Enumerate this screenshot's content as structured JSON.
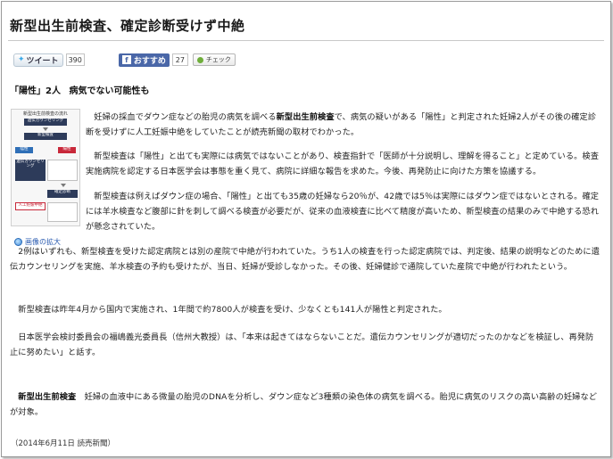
{
  "article": {
    "title": "新型出生前検査、確定診断受けず中絶",
    "share": {
      "tweet_label": "ツイート",
      "tweet_count": "390",
      "facebook_label": "おすすめ",
      "facebook_count": "27",
      "check_label": "チェック"
    },
    "subheading": {
      "part1": "「陽性」2人",
      "part2": "病気でない可能性も"
    },
    "figure": {
      "caption": "画像の拡大",
      "title": "新型出生前検査の流れ",
      "box1": "遺伝カウンセリング",
      "box2": "新型検査",
      "box3": "陰性",
      "box4": "陽性",
      "box5": "遺伝カウンセリング",
      "box6": "確定診断",
      "box7": "人工妊娠中絶"
    },
    "paragraphs": {
      "p1a": "　妊婦の採血でダウン症などの胎児の病気を調べる",
      "p1b": "新型出生前検査",
      "p1c": "で、病気の疑いがある「陽性」と判定された妊婦2人がその後の確定診断を受けずに人工妊娠中絶をしていたことが読売新聞の取材でわかった。",
      "p2": "　新型検査は「陽性」と出ても実際には病気ではないことがあり、検査指針で「医師が十分説明し、理解を得ること」と定めている。検査実施病院を認定する日本医学会は事態を重く見て、病院に詳細な報告を求めた。今後、再発防止に向けた方策を協議する。",
      "p3": "　新型検査は例えばダウン症の場合、「陽性」と出ても35歳の妊婦なら20％が、42歳では5％は実際にはダウン症ではないとされる。確定には羊水検査など腹部に針を刺して調べる検査が必要だが、従来の血液検査に比べて精度が高いため、新型検査の結果のみで中絶する恐れが懸念されていた。",
      "p4": "　2例はいずれも、新型検査を受けた認定病院とは別の産院で中絶が行われていた。うち1人の検査を行った認定病院では、判定後、結果の説明などのために遺伝カウンセリングを実施、羊水検査の予約も受けたが、当日、妊婦が受診しなかった。その後、妊婦健診で通院していた産院で中絶が行われたという。",
      "p5": "　新型検査は昨年4月から国内で実施され、1年間で約7800人が検査を受け、少なくとも141人が陽性と判定された。",
      "p6": "　日本医学会検討委員会の福嶋義光委員長（信州大教授）は、「本来は起きてはならないことだ。遺伝カウンセリングが適切だったのかなどを検証し、再発防止に努めたい」と話す。",
      "p7a": "　",
      "p7b": "新型出生前検査",
      "p7c": "　妊婦の血液中にある微量の胎児のDNAを分析し、ダウン症など3種類の染色体の病気を調べる。胎児に病気のリスクの高い高齢の妊婦などが対象。"
    },
    "source": "（2014年6月11日  読売新聞）"
  },
  "colors": {
    "facebook_blue": "#4a67a8",
    "twitter_blue": "#3aa9e8",
    "link_blue": "#2a5bb0",
    "figure_dark": "#2d3b5a",
    "figure_red": "#c8283a",
    "figure_blue": "#2f6fb7"
  },
  "icons": {
    "tweet": "bird-icon",
    "facebook": "facebook-f-icon",
    "check": "mixi-check-icon",
    "zoom": "magnifier-icon"
  }
}
